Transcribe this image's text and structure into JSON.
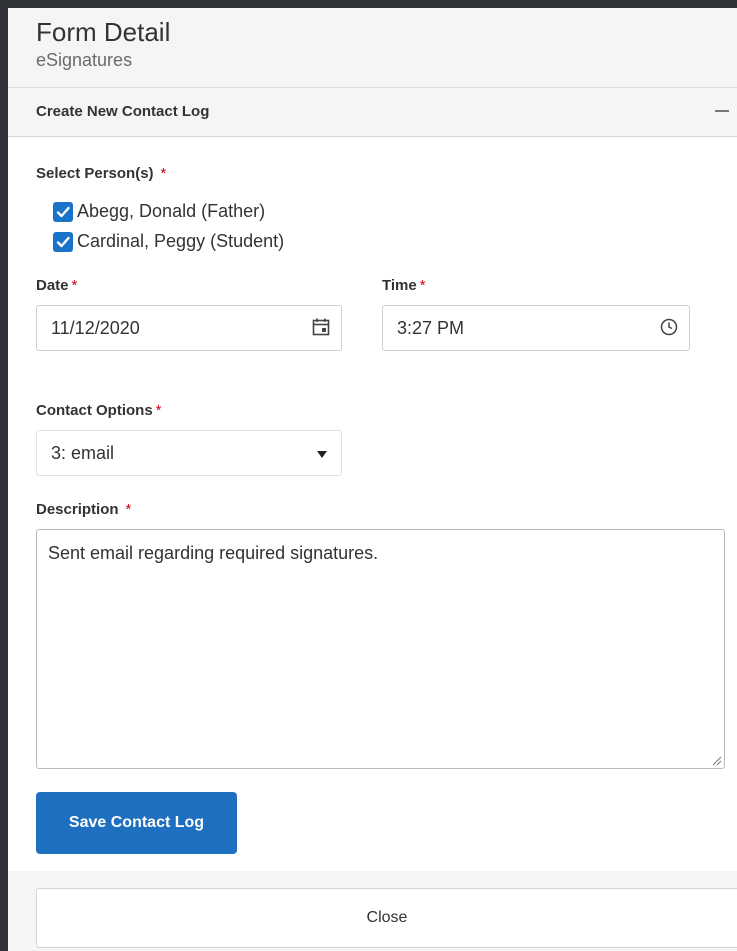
{
  "header": {
    "title": "Form Detail",
    "subtitle": "eSignatures"
  },
  "section": {
    "title": "Create New Contact Log",
    "collapse_icon": "minus-icon"
  },
  "persons": {
    "label": "Select Person(s)",
    "required": "*",
    "items": [
      {
        "label": "Abegg, Donald (Father)",
        "checked": true
      },
      {
        "label": "Cardinal, Peggy (Student)",
        "checked": true
      }
    ]
  },
  "date": {
    "label": "Date",
    "required": "*",
    "value": "11/12/2020",
    "icon": "calendar-icon"
  },
  "time": {
    "label": "Time",
    "required": "*",
    "value": "3:27 PM",
    "icon": "clock-icon"
  },
  "contact_options": {
    "label": "Contact Options",
    "required": "*",
    "value": "3: email",
    "icon": "dropdown-arrow-icon"
  },
  "description": {
    "label": "Description",
    "required": "*",
    "value": "Sent email regarding required signatures."
  },
  "actions": {
    "save_label": "Save Contact Log",
    "close_label": "Close"
  },
  "colors": {
    "primary": "#1e6fbf",
    "checkbox": "#1a73c8",
    "required": "#d0021b"
  }
}
